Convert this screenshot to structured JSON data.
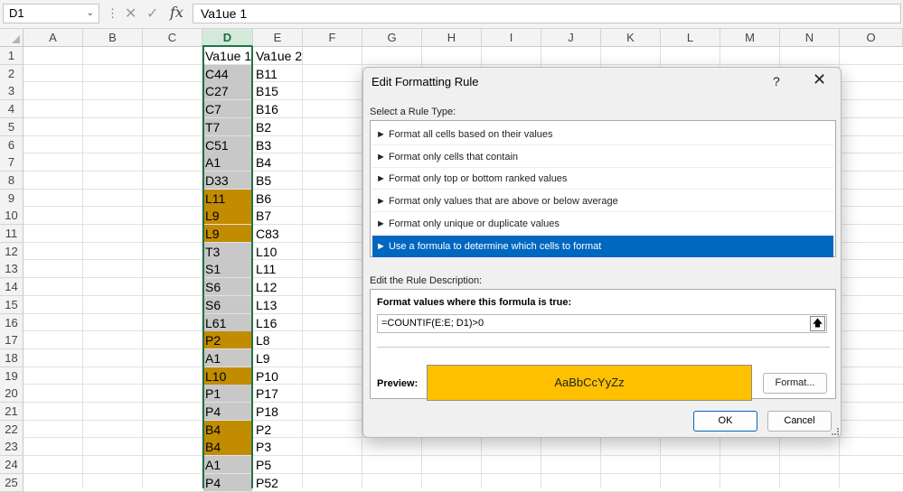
{
  "formula_bar": {
    "name_box": "D1",
    "cancel_icon": "x-icon",
    "enter_icon": "check-icon",
    "fx_label": "fx",
    "formula": "Va1ue 1"
  },
  "columns": [
    "A",
    "B",
    "C",
    "D",
    "E",
    "F",
    "G",
    "H",
    "I",
    "J",
    "K",
    "L",
    "M",
    "N",
    "O"
  ],
  "selected_column": "D",
  "rows": [
    "1",
    "2",
    "3",
    "4",
    "5",
    "6",
    "7",
    "8",
    "9",
    "10",
    "11",
    "12",
    "13",
    "14",
    "15",
    "16",
    "17",
    "18",
    "19",
    "20",
    "21",
    "22",
    "23",
    "24",
    "25"
  ],
  "cells_d": [
    "Va1ue 1",
    "C44",
    "C27",
    "C7",
    "T7",
    "C51",
    "A1",
    "D33",
    "L11",
    "L9",
    "L9",
    "T3",
    "S1",
    "S6",
    "S6",
    "L61",
    "P2",
    "A1",
    "L10",
    "P1",
    "P4",
    "B4",
    "B4",
    "A1",
    "P4"
  ],
  "cells_e": [
    "Va1ue 2",
    "B11",
    "B15",
    "B16",
    "B2",
    "B3",
    "B4",
    "B5",
    "B6",
    "B7",
    "C83",
    "L10",
    "L11",
    "L12",
    "L13",
    "L16",
    "L8",
    "L9",
    "P10",
    "P17",
    "P18",
    "P2",
    "P3",
    "P5",
    "P52"
  ],
  "highlighted_rows": [
    9,
    10,
    11,
    17,
    19,
    22,
    23
  ],
  "colors": {
    "highlight": "#c28c00",
    "column_fill": "#c8c8c8",
    "selection": "#217346",
    "preview_fill": "#ffc000",
    "list_selection": "#0067c0"
  },
  "dialog": {
    "title": "Edit Formatting Rule",
    "help_label": "?",
    "close_label": "✕",
    "select_rule_type_label": "Select a Rule Type:",
    "rule_types": [
      "► Format all cells based on their values",
      "► Format only cells that contain",
      "► Format only top or bottom ranked values",
      "► Format only values that are above or below average",
      "► Format only unique or duplicate values",
      "► Use a formula to determine which cells to format"
    ],
    "selected_rule_index": 5,
    "edit_description_label": "Edit the Rule Description:",
    "formula_heading": "Format values where this formula is true:",
    "rule_formula": "=COUNTIF(E:E; D1)>0",
    "collapse_icon": "upload-arrow-icon",
    "preview_label": "Preview:",
    "preview_text": "AaBbCcYyZz",
    "format_button": "Format...",
    "ok_button": "OK",
    "cancel_button": "Cancel"
  }
}
